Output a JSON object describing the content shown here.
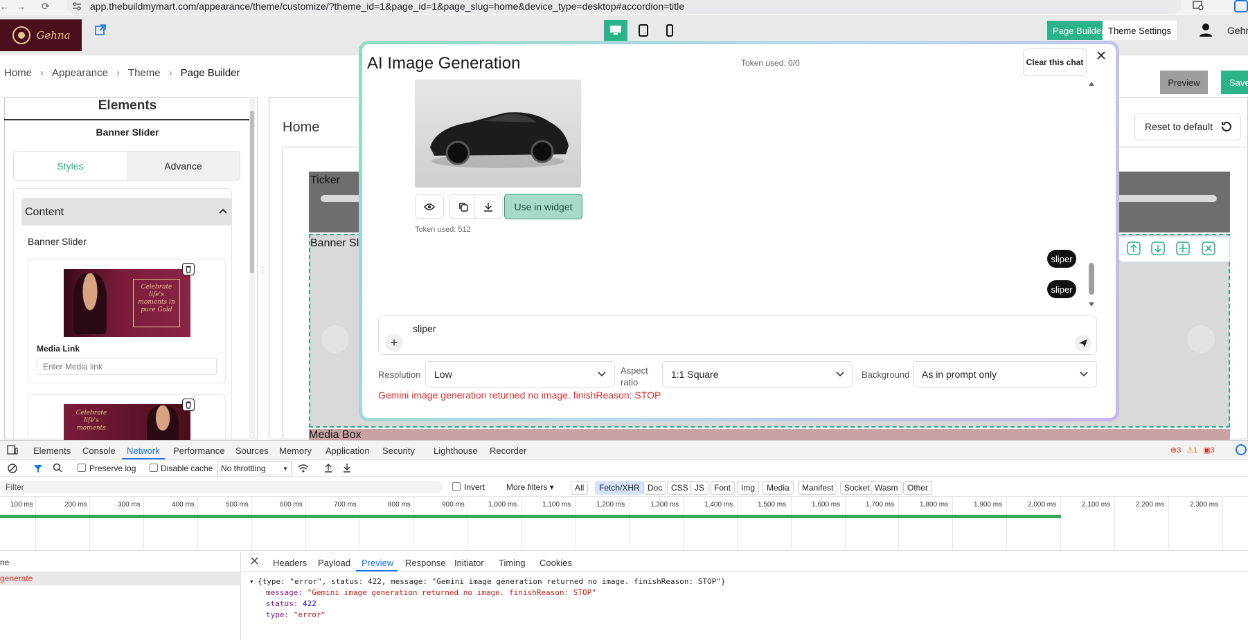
{
  "browser": {
    "url": "app.thebuildmymart.com/appearance/theme/customize/?theme_id=1&page_id=1&page_slug=home&device_type=desktop#accordion=title"
  },
  "header": {
    "logo_text": "Gehna",
    "page_builder_label": "Page Builder",
    "theme_settings_label": "Theme Settings",
    "user_name": "Gehn",
    "preview_label": "Preview",
    "save_label": "Save",
    "accent_color": "#2bb38a"
  },
  "breadcrumb": [
    "Home",
    "Appearance",
    "Theme",
    "Page Builder"
  ],
  "left_panel": {
    "title": "Elements",
    "subtitle": "Banner Slider",
    "tabs": [
      "Styles",
      "Advance"
    ],
    "active_tab": "Styles",
    "section_title": "Content",
    "section_item": "Banner Slider",
    "slide1_text": "Celebrate life's moments in pure Gold",
    "slide2_text": "Celebrate life's moments",
    "media_link_label": "Media Link",
    "media_link_placeholder": "Enter Media link"
  },
  "canvas": {
    "page_title": "Home",
    "reset_label": "Reset to default",
    "ticker_label": "Ticker",
    "banner_label": "Banner Sl",
    "media_box_label": "Media Box"
  },
  "modal": {
    "title": "AI Image Generation",
    "token_used_header": "Token used: 0/0",
    "clear_chat_label": "Clear this chat",
    "use_in_widget_label": "Use in widget",
    "token_used_image": "Token used: 512",
    "messages": [
      "sliper",
      "sliper"
    ],
    "input_value": "sliper",
    "resolution_label": "Resolution",
    "resolution_value": "Low",
    "aspect_label": "Aspect ratio",
    "aspect_value": "1:1 Square",
    "background_label": "Background",
    "background_value": "As in prompt only",
    "error_text": "Gemini image generation returned no image. finishReason: STOP",
    "error_color": "#e03131"
  },
  "devtools": {
    "tabs": [
      "Elements",
      "Console",
      "Network",
      "Performance",
      "Sources",
      "Memory",
      "Application",
      "Security",
      "Lighthouse",
      "Recorder"
    ],
    "active_tab": "Network",
    "errors": "3",
    "warnings": "1",
    "issues": "3",
    "preserve_log": "Preserve log",
    "disable_cache": "Disable cache",
    "throttling": "No throttling",
    "filter_placeholder": "Filter",
    "invert": "Invert",
    "more_filters": "More filters",
    "filter_chips": [
      "All",
      "Fetch/XHR",
      "Doc",
      "CSS",
      "JS",
      "Font",
      "Img",
      "Media",
      "Manifest",
      "Socket",
      "Wasm",
      "Other"
    ],
    "active_chip": "Fetch/XHR",
    "ticks": [
      "100 ms",
      "200 ms",
      "300 ms",
      "400 ms",
      "500 ms",
      "600 ms",
      "700 ms",
      "800 ms",
      "900 ms",
      "1,000 ms",
      "1,100 ms",
      "1,200 ms",
      "1,300 ms",
      "1,400 ms",
      "1,500 ms",
      "1,600 ms",
      "1,700 ms",
      "1,800 ms",
      "1,900 ms",
      "2,000 ms",
      "2,100 ms",
      "2,200 ms",
      "2,300 ms"
    ],
    "request_col_header": "ne",
    "request_name": "generate",
    "response_tabs": [
      "Headers",
      "Payload",
      "Preview",
      "Response",
      "Initiator",
      "Timing",
      "Cookies"
    ],
    "active_response_tab": "Preview",
    "preview_summary": "{type: \"error\", status: 422, message: \"Gemini image generation returned no image. finishReason: STOP\"}",
    "message_key": "message:",
    "message_val": "\"Gemini image generation returned no image. finishReason: STOP\"",
    "status_key": "status:",
    "status_val": "422",
    "type_key": "type:",
    "type_val": "\"error\""
  }
}
